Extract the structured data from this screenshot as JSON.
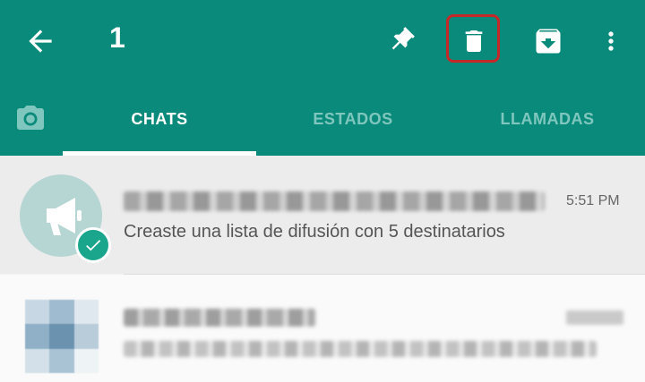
{
  "app_bar": {
    "selected_count": "1",
    "background": "#0a8a7a",
    "actions": [
      "arrow-left-icon",
      "pin-icon",
      "trash-icon",
      "archive-icon",
      "more-vert-icon"
    ],
    "highlighted_action": "delete",
    "highlight_color": "#c62828"
  },
  "tabs": [
    {
      "label": "CHATS",
      "active": true
    },
    {
      "label": "ESTADOS",
      "active": false
    },
    {
      "label": "LLAMADAS",
      "active": false
    }
  ],
  "chats": [
    {
      "time": "5:51 PM",
      "preview": "Creaste una lista de difusión con 5 destinatarios",
      "selected": true,
      "avatar": "megaphone-icon"
    },
    {
      "selected": false
    }
  ]
}
